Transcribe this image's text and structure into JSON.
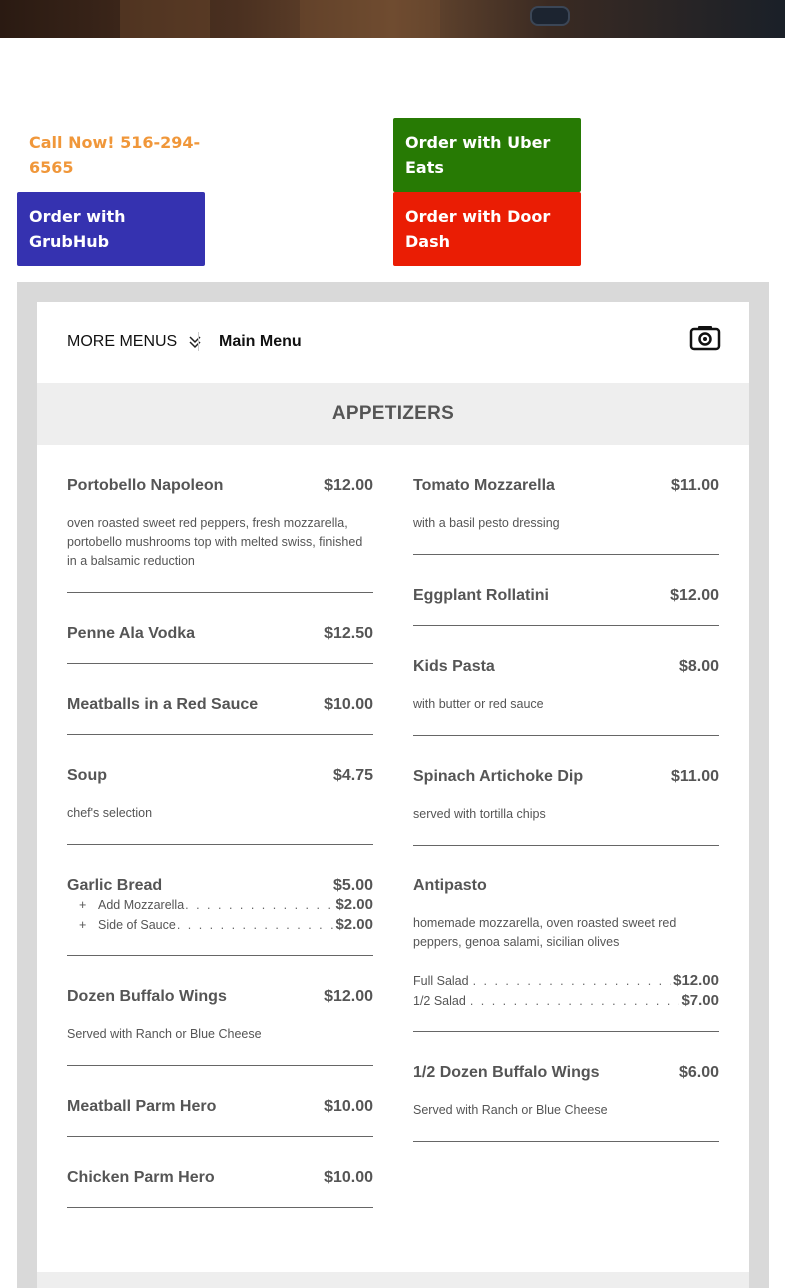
{
  "call": {
    "text": "Call Now! 516-294-6565"
  },
  "buttons": {
    "uber": "Order with Uber Eats",
    "doordash": "Order with Door Dash",
    "grubhub": "Order with GrubHub"
  },
  "colors": {
    "call": "#f0973a",
    "uber": "#277a04",
    "doordash": "#ea1d04",
    "grubhub": "#3532b0"
  },
  "menu_nav": {
    "more_menus": "MORE MENUS",
    "current_menu": "Main Menu"
  },
  "section": {
    "title": "APPETIZERS"
  },
  "left_items": [
    {
      "name": "Portobello Napoleon",
      "price": "$12.00",
      "desc": "oven roasted sweet red peppers, fresh mozzarella, portobello mushrooms top with melted swiss, finished in a balsamic reduction"
    },
    {
      "name": "Penne Ala Vodka",
      "price": "$12.50"
    },
    {
      "name": "Meatballs in a Red Sauce",
      "price": "$10.00"
    },
    {
      "name": "Soup",
      "price": "$4.75",
      "desc": "chef's selection"
    },
    {
      "name": "Garlic Bread",
      "price": "$5.00",
      "addons": [
        {
          "label": "Add Mozzarella",
          "price": "$2.00"
        },
        {
          "label": "Side of Sauce",
          "price": "$2.00"
        }
      ]
    },
    {
      "name": "Dozen Buffalo Wings",
      "price": "$12.00",
      "desc": "Served with Ranch or Blue Cheese"
    },
    {
      "name": "Meatball Parm Hero",
      "price": "$10.00"
    },
    {
      "name": "Chicken Parm Hero",
      "price": "$10.00"
    }
  ],
  "right_items": [
    {
      "name": "Tomato Mozzarella",
      "price": "$11.00",
      "desc": "with a basil pesto dressing"
    },
    {
      "name": "Eggplant Rollatini",
      "price": "$12.00"
    },
    {
      "name": "Kids Pasta",
      "price": "$8.00",
      "desc": "with butter or red sauce"
    },
    {
      "name": "Spinach Artichoke Dip",
      "price": "$11.00",
      "desc": "served with tortilla chips"
    },
    {
      "name": "Antipasto",
      "price": "",
      "desc": "homemade mozzarella, oven roasted sweet red peppers, genoa salami, sicilian olives",
      "sizes": [
        {
          "label": "Full Salad",
          "price": "$12.00"
        },
        {
          "label": "1/2 Salad",
          "price": "$7.00"
        }
      ]
    },
    {
      "name": "1/2 Dozen Buffalo Wings",
      "price": "$6.00",
      "desc": "Served with Ranch or Blue Cheese"
    }
  ]
}
